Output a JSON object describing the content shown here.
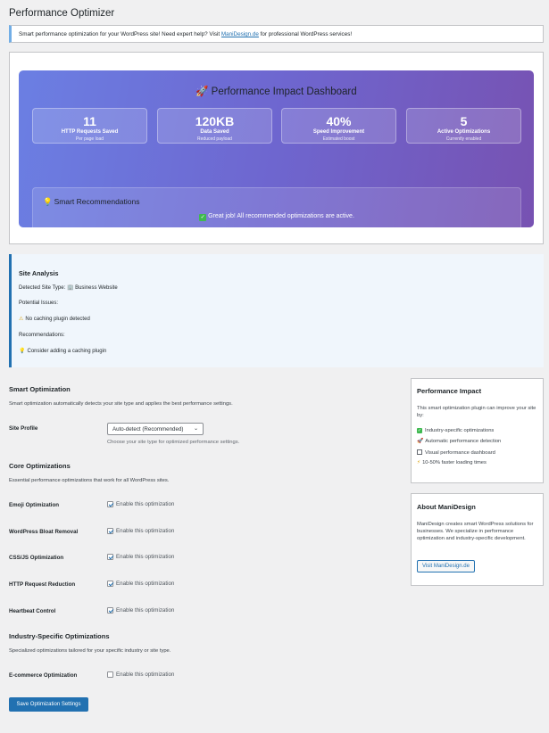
{
  "page": {
    "title": "Performance Optimizer"
  },
  "notice": {
    "text_before": "Smart performance optimization for your WordPress site! Need expert help? Visit ",
    "link_text": "ManiDesign.de",
    "text_after": " for professional WordPress services!"
  },
  "dashboard": {
    "title": "Performance Impact Dashboard",
    "stats": [
      {
        "value": "11",
        "label": "HTTP Requests Saved",
        "sub": "Per page load"
      },
      {
        "value": "120KB",
        "label": "Data Saved",
        "sub": "Reduced payload"
      },
      {
        "value": "40%",
        "label": "Speed Improvement",
        "sub": "Estimated boost"
      },
      {
        "value": "5",
        "label": "Active Optimizations",
        "sub": "Currently enabled"
      }
    ],
    "recommendations": {
      "title": "Smart Recommendations",
      "message": "Great job! All recommended optimizations are active."
    }
  },
  "analysis": {
    "title": "Site Analysis",
    "site_type_label": "Detected Site Type:",
    "site_type_value": "Business Website",
    "issues_label": "Potential Issues:",
    "issue": "No caching plugin detected",
    "recommendations_label": "Recommendations:",
    "recommendation": "Consider adding a caching plugin"
  },
  "smart": {
    "title": "Smart Optimization",
    "desc": "Smart optimization automatically detects your site type and applies the best performance settings.",
    "profile_label": "Site Profile",
    "profile_value": "Auto-detect (Recommended)",
    "profile_help": "Choose your site type for optimized performance settings."
  },
  "core": {
    "title": "Core Optimizations",
    "desc": "Essential performance optimizations that work for all WordPress sites.",
    "items": [
      {
        "label": "Emoji Optimization",
        "checkbox": "Enable this optimization",
        "checked": true
      },
      {
        "label": "WordPress Bloat Removal",
        "checkbox": "Enable this optimization",
        "checked": true
      },
      {
        "label": "CSS/JS Optimization",
        "checkbox": "Enable this optimization",
        "checked": true
      },
      {
        "label": "HTTP Request Reduction",
        "checkbox": "Enable this optimization",
        "checked": true
      },
      {
        "label": "Heartbeat Control",
        "checkbox": "Enable this optimization",
        "checked": true
      }
    ]
  },
  "industry": {
    "title": "Industry-Specific Optimizations",
    "desc": "Specialized optimizations tailored for your specific industry or site type.",
    "items": [
      {
        "label": "E-commerce Optimization",
        "checkbox": "Enable this optimization",
        "checked": false
      }
    ]
  },
  "save_button": "Save Optimization Settings",
  "sidebar": {
    "impact": {
      "title": "Performance Impact",
      "text": "This smart optimization plugin can improve your site by:",
      "items": [
        "Industry-specific optimizations",
        "Automatic performance detection",
        "Visual performance dashboard",
        "10-50% faster loading times"
      ]
    },
    "about": {
      "title": "About ManiDesign",
      "text": "ManiDesign creates smart WordPress solutions for businesses. We specialize in performance optimization and industry-specific development.",
      "button": "Visit ManiDesign.de"
    }
  },
  "colors": {
    "accent": "#2271b1",
    "gradient_start": "#6b7fe3",
    "gradient_end": "#7752b2",
    "success": "#3fb950"
  }
}
